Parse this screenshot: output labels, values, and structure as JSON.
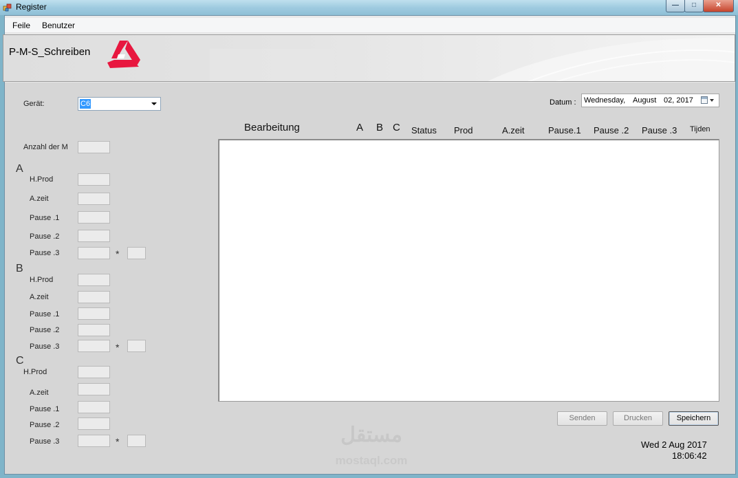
{
  "window": {
    "title": "Register"
  },
  "menu": {
    "items": [
      "Feile",
      "Benutzer"
    ]
  },
  "header": {
    "app_name": "P-M-S_Schreiben"
  },
  "form": {
    "geraet_label": "Gerät:",
    "geraet_value": "C6",
    "anzahl_label": "Anzahl der M",
    "sections": [
      {
        "name": "A",
        "fields": [
          "H.Prod",
          "A.zeit",
          "Pause .1",
          "Pause .2",
          "Pause .3"
        ]
      },
      {
        "name": "B",
        "fields": [
          "H.Prod",
          "A.zeit",
          "Pause .1",
          "Pause .2",
          "Pause .3"
        ]
      },
      {
        "name": "C",
        "fields": [
          "H.Prod",
          "A.zeit",
          "Pause .1",
          "Pause .2",
          "Pause .3"
        ]
      }
    ],
    "multiplier_symbol": "*"
  },
  "date": {
    "label": "Datum :",
    "day": "Wednesday,",
    "month": "August",
    "date": "02, 2017"
  },
  "table": {
    "columns": [
      "Bearbeitung",
      "A",
      "B",
      "C",
      "Status",
      "Prod",
      "A.zeit",
      "Pause.1",
      "Pause .2",
      "Pause .3",
      "Tijden"
    ]
  },
  "buttons": {
    "send": "Senden",
    "print": "Drucken",
    "save": "Speichern"
  },
  "clock": {
    "date": "Wed 2 Aug 2017",
    "time": "18:06:42"
  },
  "watermark": {
    "text": "مستقل",
    "sub": "mostaql.com"
  }
}
